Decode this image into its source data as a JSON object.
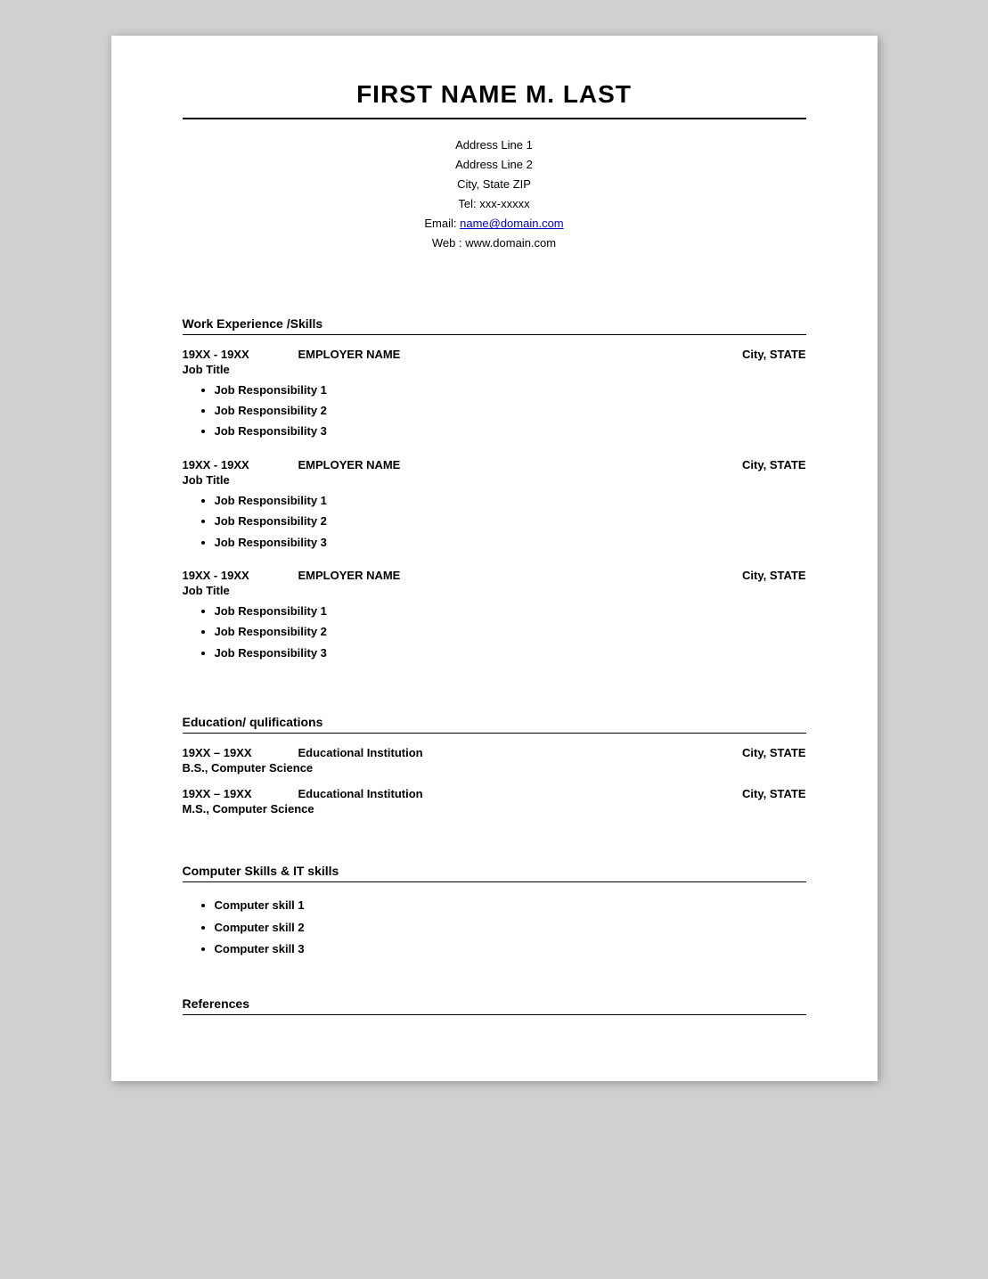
{
  "header": {
    "name": "FIRST NAME M. LAST"
  },
  "contact": {
    "address_line1": "Address Line 1",
    "address_line2": "Address Line 2",
    "city_state_zip": "City, State ZIP",
    "tel_label": "Tel:",
    "tel_value": "xxx-xxxxx",
    "email_label": "Email:",
    "email_address": "name@domain.com",
    "web_label": "Web :",
    "web_value": "www.domain.com"
  },
  "sections": {
    "work_experience": {
      "title": "Work Experience /Skills",
      "jobs": [
        {
          "dates": "19XX - 19XX",
          "employer": "EMPLOYER NAME",
          "location": "City, STATE",
          "title": "Job Title",
          "responsibilities": [
            "Job Responsibility 1",
            "Job Responsibility 2",
            "Job Responsibility 3"
          ]
        },
        {
          "dates": "19XX - 19XX",
          "employer": "EMPLOYER NAME",
          "location": "City, STATE",
          "title": "Job Title",
          "responsibilities": [
            "Job Responsibility 1",
            "Job Responsibility 2",
            "Job Responsibility 3"
          ]
        },
        {
          "dates": "19XX - 19XX",
          "employer": "EMPLOYER NAME",
          "location": "City, STATE",
          "title": "Job Title",
          "responsibilities": [
            "Job Responsibility 1",
            "Job Responsibility 2",
            "Job Responsibility 3"
          ]
        }
      ]
    },
    "education": {
      "title": "Education/ qulifications",
      "entries": [
        {
          "dates": "19XX – 19XX",
          "institution": "Educational Institution",
          "location": "City, STATE",
          "degree": "B.S., Computer Science"
        },
        {
          "dates": "19XX – 19XX",
          "institution": "Educational Institution",
          "location": "City, STATE",
          "degree": "M.S., Computer Science"
        }
      ]
    },
    "computer_skills": {
      "title": "Computer Skills & IT skills",
      "skills": [
        "Computer skill 1",
        "Computer skill 2",
        "Computer skill 3"
      ]
    },
    "references": {
      "title": "References"
    }
  }
}
